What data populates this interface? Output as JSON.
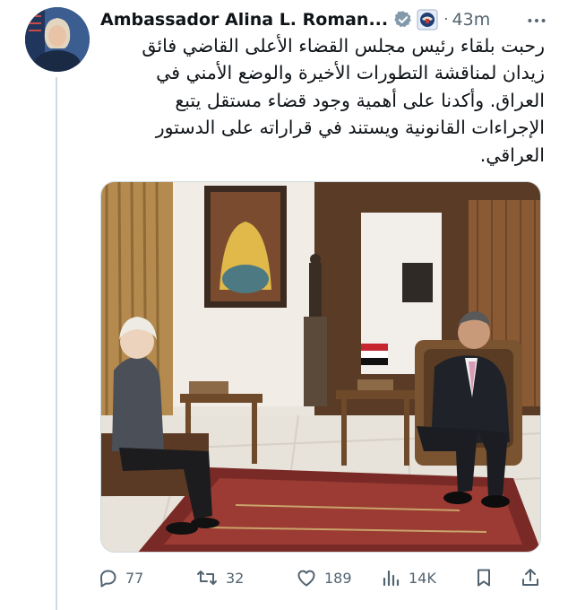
{
  "tweet": {
    "author_name": "Ambassador Alina L. Roman...",
    "separator": "·",
    "timestamp": "43m",
    "text_lines": [
      "رحبت بلقاء رئيس مجلس القضاء الأعلى القاضي فائق",
      "زيدان لمناقشة التطورات الأخيرة والوضع الأمني في",
      "العراق. وأكدنا على أهمية وجود قضاء مستقل يتبع",
      "الإجراءات القانونية ويستند في قراراته على الدستور",
      "العراقي."
    ]
  },
  "actions": {
    "replies": "77",
    "retweets": "32",
    "likes": "189",
    "views": "14K"
  },
  "icons": {
    "verified": "verified-badge-icon",
    "seal": "us-seal-icon",
    "more": "more-icon",
    "reply": "reply-icon",
    "retweet": "retweet-icon",
    "like": "heart-icon",
    "views": "views-icon",
    "bookmark": "bookmark-icon",
    "share": "share-icon"
  },
  "colors": {
    "text": "#0f1419",
    "secondary": "#536471",
    "verified_gray": "#829aab",
    "thread_line": "#cfd9de"
  }
}
